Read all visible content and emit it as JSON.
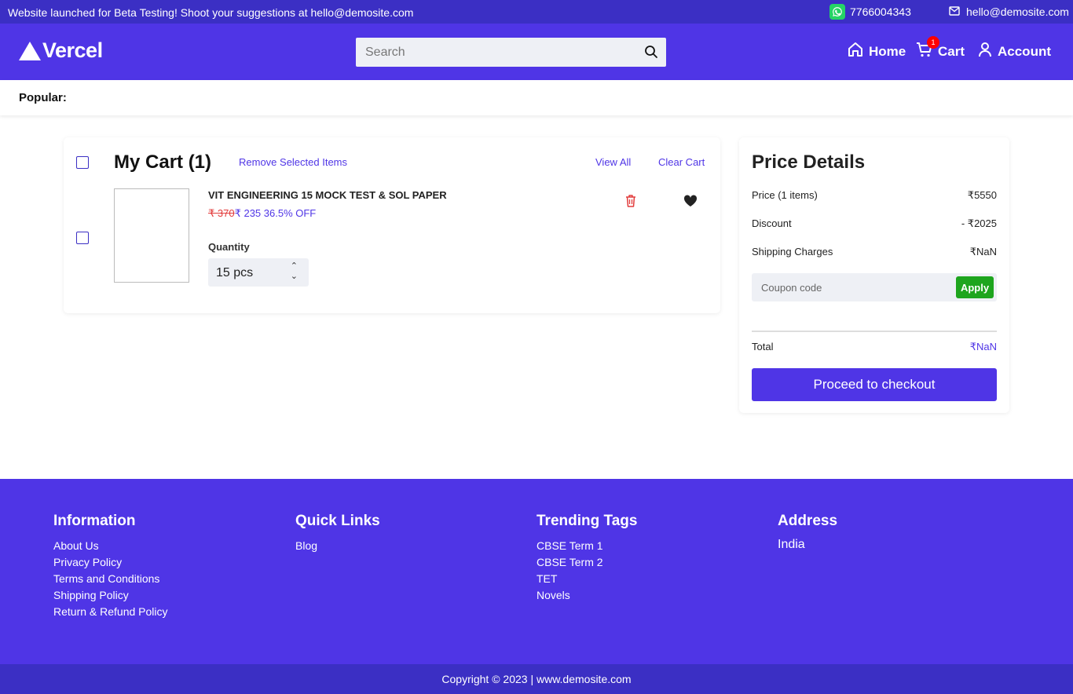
{
  "topbar": {
    "message": "Website launched for Beta Testing! Shoot your suggestions at hello@demosite.com",
    "phone": "7766004343",
    "email": "hello@demosite.com"
  },
  "header": {
    "logo": "Vercel",
    "search_placeholder": "Search",
    "nav": {
      "home": "Home",
      "cart": "Cart",
      "account": "Account",
      "cart_count": "1"
    }
  },
  "popular": {
    "label": "Popular:"
  },
  "cart": {
    "title": "My Cart (1)",
    "remove_selected": "Remove Selected Items",
    "view_all": "View All",
    "clear_cart": "Clear Cart",
    "items": [
      {
        "name": "VIT ENGINEERING 15 MOCK TEST & SOL PAPER",
        "old_price": "₹ 370",
        "new_price": "₹ 235",
        "discount": "36.5% OFF",
        "quantity_label": "Quantity",
        "quantity": "15 pcs"
      }
    ]
  },
  "price_details": {
    "title": "Price Details",
    "price_label": "Price (1 items)",
    "price_value": "₹5550",
    "discount_label": "Discount",
    "discount_value": "- ₹2025",
    "shipping_label": "Shipping Charges",
    "shipping_value": "₹NaN",
    "coupon_placeholder": "Coupon code",
    "apply_label": "Apply",
    "total_label": "Total",
    "total_value": "₹NaN",
    "checkout_label": "Proceed to checkout"
  },
  "footer": {
    "information": {
      "title": "Information",
      "links": [
        "About Us",
        "Privacy Policy",
        "Terms and Conditions",
        "Shipping Policy",
        "Return & Refund Policy"
      ]
    },
    "quick_links": {
      "title": "Quick Links",
      "links": [
        "Blog"
      ]
    },
    "trending": {
      "title": "Trending Tags",
      "links": [
        "CBSE Term 1",
        "CBSE Term 2",
        "TET",
        "Novels"
      ]
    },
    "address": {
      "title": "Address",
      "value": "India"
    },
    "copyright": "Copyright © 2023 | www.demosite.com"
  },
  "colors": {
    "primary": "#4f35e6",
    "topbar": "#3b2fc4",
    "apply": "#1ea51e",
    "old_price": "#e23c3c"
  }
}
